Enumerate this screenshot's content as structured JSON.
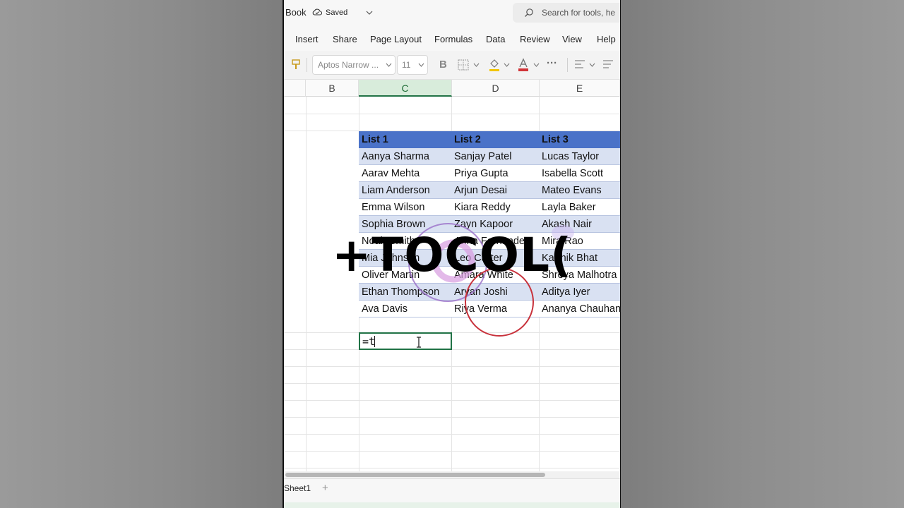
{
  "header": {
    "book_label": "Book",
    "saved_label": "Saved",
    "search_placeholder": "Search for tools, he"
  },
  "menu": [
    "Insert",
    "Share",
    "Page Layout",
    "Formulas",
    "Data",
    "Review",
    "View",
    "Help"
  ],
  "toolbar": {
    "font_name": "Aptos Narrow ...",
    "font_size": "11",
    "bold_label": "B",
    "more_label": "···"
  },
  "columns": [
    "B",
    "C",
    "D",
    "E"
  ],
  "selected_column": "C",
  "table": {
    "headers": [
      "List 1",
      "List 2",
      "List 3"
    ],
    "rows": [
      [
        "Aanya Sharma",
        "Sanjay Patel",
        "Lucas Taylor"
      ],
      [
        "Aarav Mehta",
        "Priya Gupta",
        "Isabella Scott"
      ],
      [
        "Liam Anderson",
        "Arjun Desai",
        "Mateo Evans"
      ],
      [
        "Emma Wilson",
        "Kiara Reddy",
        "Layla Baker"
      ],
      [
        "Sophia Brown",
        "Zayn Kapoor",
        "Akash Nair"
      ],
      [
        "Noah Smith",
        "Anna Fernandes",
        "Mira Rao"
      ],
      [
        "Mia Johnson",
        "Leo Carter",
        "Karthik Bhat"
      ],
      [
        "Oliver Martin",
        "Amara White",
        "Shreya Malhotra"
      ],
      [
        "Ethan Thompson",
        "Aryan Joshi",
        "Aditya Iyer"
      ],
      [
        "Ava Davis",
        "Riya Verma",
        "Ananya Chauhan"
      ]
    ]
  },
  "active_cell": {
    "value": "=t"
  },
  "overlay_caption": "+TOCOL(",
  "sheet_tab": "Sheet1",
  "add_sheet_label": "+",
  "colors": {
    "accent": "#217346",
    "table_header": "#4a72c8",
    "band": "#d9e1f2"
  }
}
